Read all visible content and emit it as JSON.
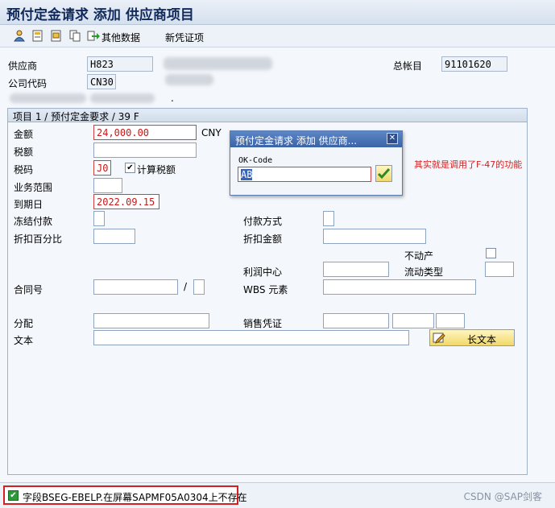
{
  "title": "预付定金请求 添加 供应商项目",
  "toolbar": {
    "other_data": "其他数据",
    "new_voucher": "新凭证项"
  },
  "header": {
    "vendor_label": "供应商",
    "vendor_value": "H823",
    "company_label": "公司代码",
    "company_value": "CN30",
    "gl_label": "总帐目",
    "gl_value": "91101620",
    "dot": "."
  },
  "group": {
    "title": "项目 1 / 预付定金要求 / 39 F"
  },
  "form": {
    "amount_label": "金额",
    "amount_value": "24,000.00",
    "currency": "CNY",
    "tax_amount_label": "税额",
    "tax_code_label": "税码",
    "tax_code_value": "J0",
    "calc_tax_label": "计算税额",
    "calc_tax_checked": "✔",
    "business_area_label": "业务范围",
    "due_date_label": "到期日",
    "due_date_value": "2022.09.15",
    "payment_block_label": "冻结付款",
    "payment_method_label": "付款方式",
    "discount_pct_label": "折扣百分比",
    "discount_amount_label": "折扣金额",
    "real_estate_label": "不动产",
    "profit_center_label": "利润中心",
    "flow_type_label": "流动类型",
    "contract_label": "合同号",
    "slash": "/",
    "wbs_label": "WBS 元素",
    "assignment_label": "分配",
    "sales_doc_label": "销售凭证",
    "text_label": "文本",
    "long_text_button": "长文本"
  },
  "dialog": {
    "title": "预付定金请求 添加 供应商...",
    "close": "✕",
    "field_label": "OK-Code",
    "field_value": "AB"
  },
  "annotation": {
    "text": "其实就是调用了F-47的功能",
    "color": "#d42020"
  },
  "status": {
    "icon": "✔",
    "message": "字段BSEG-EBELP.在屏幕SAPMF05A0304上不存在"
  },
  "watermark": "CSDN @SAP剑客"
}
